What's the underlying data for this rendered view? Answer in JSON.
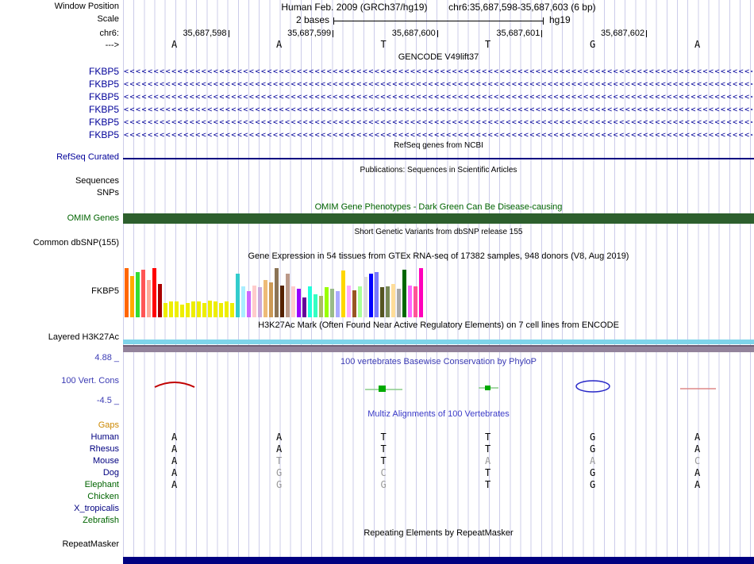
{
  "header": {
    "window_position_label": "Window Position",
    "assembly": "Human Feb. 2009 (GRCh37/hg19)",
    "position": "chr6:35,687,598-35,687,603 (6 bp)",
    "scale_label": "Scale",
    "scale_value": "2 bases",
    "assembly_short": "hg19",
    "chrom_label": "chr6:",
    "strand_label": "--->",
    "coordinates": [
      "35,687,598",
      "35,687,599",
      "35,687,600",
      "35,687,601",
      "35,687,602"
    ],
    "reference_bases": [
      "A",
      "A",
      "T",
      "T",
      "G",
      "A"
    ]
  },
  "gencode": {
    "title": "GENCODE V49lift37",
    "gene_label": "FKBP5",
    "row_count": 6,
    "strand_direction": "left",
    "color": "#000099"
  },
  "refseq": {
    "title": "RefSeq genes from NCBI",
    "label": "RefSeq Curated",
    "line_color": "#000080"
  },
  "publications": {
    "title": "Publications: Sequences in Scientific Articles",
    "row_labels": [
      "Sequences",
      "SNPs"
    ]
  },
  "omim": {
    "title": "OMIM Gene Phenotypes - Dark Green Can Be Disease-causing",
    "label": "OMIM Genes",
    "title_color": "#006400",
    "bar_color": "#2d5f2d"
  },
  "dbsnp": {
    "title": "Short Genetic Variants from dbSNP release 155",
    "label": "Common dbSNP(155)"
  },
  "gtex": {
    "title": "Gene Expression in 54 tissues from GTEx RNA-seq of 17382 samples, 948 donors (V8, Aug 2019)",
    "label": "FKBP5"
  },
  "encode": {
    "title": "H3K27Ac Mark (Often Found Near Active Regulatory Elements) on 7 cell lines from ENCODE",
    "label": "Layered H3K27Ac",
    "bar1_color": "#7fd4ea",
    "bar2_color": "#93839b"
  },
  "phylop": {
    "title": "100 vertebrates Basewise Conservation by PhyloP",
    "label": "100 Vert. Cons",
    "max_label": "4.88 _",
    "min_label": "-4.5 _",
    "title_color": "#3b3bb4"
  },
  "multiz": {
    "title": "Multiz Alignments of 100 Vertebrates",
    "gaps_label": "Gaps",
    "gaps_color": "#cc8800",
    "rows": [
      {
        "name": "Human",
        "label_color": "#000080",
        "bases": [
          "A",
          "A",
          "T",
          "T",
          "G",
          "A"
        ],
        "gray": [
          false,
          false,
          false,
          false,
          false,
          false
        ]
      },
      {
        "name": "Rhesus",
        "label_color": "#000080",
        "bases": [
          "A",
          "A",
          "T",
          "T",
          "G",
          "A"
        ],
        "gray": [
          false,
          false,
          false,
          false,
          false,
          false
        ]
      },
      {
        "name": "Mouse",
        "label_color": "#000080",
        "bases": [
          "A",
          "T",
          "T",
          "A",
          "A",
          "C"
        ],
        "gray": [
          false,
          true,
          false,
          true,
          true,
          true
        ]
      },
      {
        "name": "Dog",
        "label_color": "#000080",
        "bases": [
          "A",
          "G",
          "C",
          "T",
          "G",
          "A"
        ],
        "gray": [
          false,
          true,
          true,
          false,
          false,
          false
        ]
      },
      {
        "name": "Elephant",
        "label_color": "#006400",
        "bases": [
          "A",
          "G",
          "G",
          "T",
          "G",
          "A"
        ],
        "gray": [
          false,
          true,
          true,
          false,
          false,
          false
        ]
      },
      {
        "name": "Chicken",
        "label_color": "#006400",
        "bases": [
          "",
          "",
          "",
          "",
          "",
          ""
        ],
        "gray": [
          false,
          false,
          false,
          false,
          false,
          false
        ]
      },
      {
        "name": "X_tropicalis",
        "label_color": "#000080",
        "bases": [
          "",
          "",
          "",
          "",
          "",
          ""
        ],
        "gray": [
          false,
          false,
          false,
          false,
          false,
          false
        ]
      },
      {
        "name": "Zebrafish",
        "label_color": "#006400",
        "bases": [
          "",
          "",
          "",
          "",
          "",
          ""
        ],
        "gray": [
          false,
          false,
          false,
          false,
          false,
          false
        ]
      }
    ]
  },
  "repeatmasker": {
    "title": "Repeating Elements by RepeatMasker",
    "label": "RepeatMasker",
    "bottom_bar_color": "#000080"
  },
  "chart_data": {
    "type": "bar",
    "track": "GTEx gene expression bar chart",
    "gene": "FKBP5",
    "title": "Gene Expression in 54 tissues from GTEx RNA-seq of 17382 samples, 948 donors (V8, Aug 2019)",
    "n_bars": 54,
    "note": "values are relative bar heights (0-1 of tallest bar) read from pixels; tissue names are not rendered in the screenshot",
    "colors": [
      "#FF6600",
      "#FFAA00",
      "#33DD33",
      "#FF5555",
      "#FFAA99",
      "#FF0000",
      "#AA0000",
      "#EEEE00",
      "#EEEE00",
      "#EEEE00",
      "#EEEE00",
      "#EEEE00",
      "#EEEE00",
      "#EEEE00",
      "#EEEE00",
      "#EEEE00",
      "#EEEE00",
      "#EEEE00",
      "#EEEE00",
      "#EEEE00",
      "#33CCCC",
      "#AAEEFF",
      "#CC66FF",
      "#FFCCCC",
      "#CCAADD",
      "#EEBB77",
      "#CC9955",
      "#8B7355",
      "#552200",
      "#BB9988",
      "#FFCCCC",
      "#9900FF",
      "#660099",
      "#22FFDD",
      "#33FFC2",
      "#AABB66",
      "#99FF00",
      "#99BB88",
      "#AAAAFF",
      "#FFD700",
      "#FFAAFF",
      "#995522",
      "#AAFF99",
      "#DDDDDD",
      "#0000FF",
      "#7777FF",
      "#555522",
      "#778855",
      "#FFDD99",
      "#AAAAAA",
      "#006600",
      "#FF66FF",
      "#FF5599",
      "#FF00BB"
    ],
    "values": [
      0.95,
      0.8,
      0.88,
      0.92,
      0.72,
      0.95,
      0.65,
      0.28,
      0.3,
      0.3,
      0.25,
      0.27,
      0.3,
      0.3,
      0.28,
      0.32,
      0.3,
      0.28,
      0.3,
      0.27,
      0.85,
      0.6,
      0.5,
      0.62,
      0.58,
      0.72,
      0.68,
      0.95,
      0.62,
      0.85,
      0.6,
      0.55,
      0.38,
      0.6,
      0.45,
      0.42,
      0.58,
      0.55,
      0.5,
      0.9,
      0.62,
      0.52,
      0.6,
      0.78,
      0.85,
      0.88,
      0.58,
      0.6,
      0.65,
      0.55,
      0.92,
      0.62,
      0.6,
      0.95
    ]
  }
}
